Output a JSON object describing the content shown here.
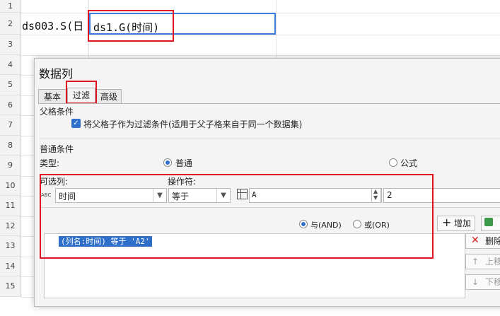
{
  "sheet": {
    "row_numbers": [
      "1",
      "2",
      "3",
      "4",
      "5",
      "6",
      "7",
      "8",
      "9",
      "10",
      "11",
      "12",
      "13",
      "14",
      "15"
    ],
    "cell_a2": "ds003.S(日",
    "cell_b2": "ds1.G(时间)"
  },
  "dialog": {
    "title": "数据列",
    "tabs": [
      "基本",
      "过滤",
      "高级"
    ],
    "parent_section": "父格条件",
    "parent_checkbox_label": "将父格子作为过滤条件(适用于父子格来自于同一个数据集)",
    "common_section": "普通条件",
    "type_label": "类型:",
    "type_normal": "普通",
    "type_formula": "公式",
    "column_label": "可选列:",
    "operator_label": "操作符:",
    "column_value": "时间",
    "operator_value": "等于",
    "value_text": "A",
    "spinner_value": "2",
    "and_label": "与(AND)",
    "or_label": "或(OR)",
    "add_button": "增加",
    "side_buttons": [
      "删除",
      "上移",
      "下移"
    ],
    "condition_row": "(列名:时间) 等于 'A2'",
    "abc_icon_text": "ABC"
  },
  "colors": {
    "highlight": "#e0141e",
    "selection": "#2f6fc9",
    "cell_border": "#3c7ddc"
  }
}
